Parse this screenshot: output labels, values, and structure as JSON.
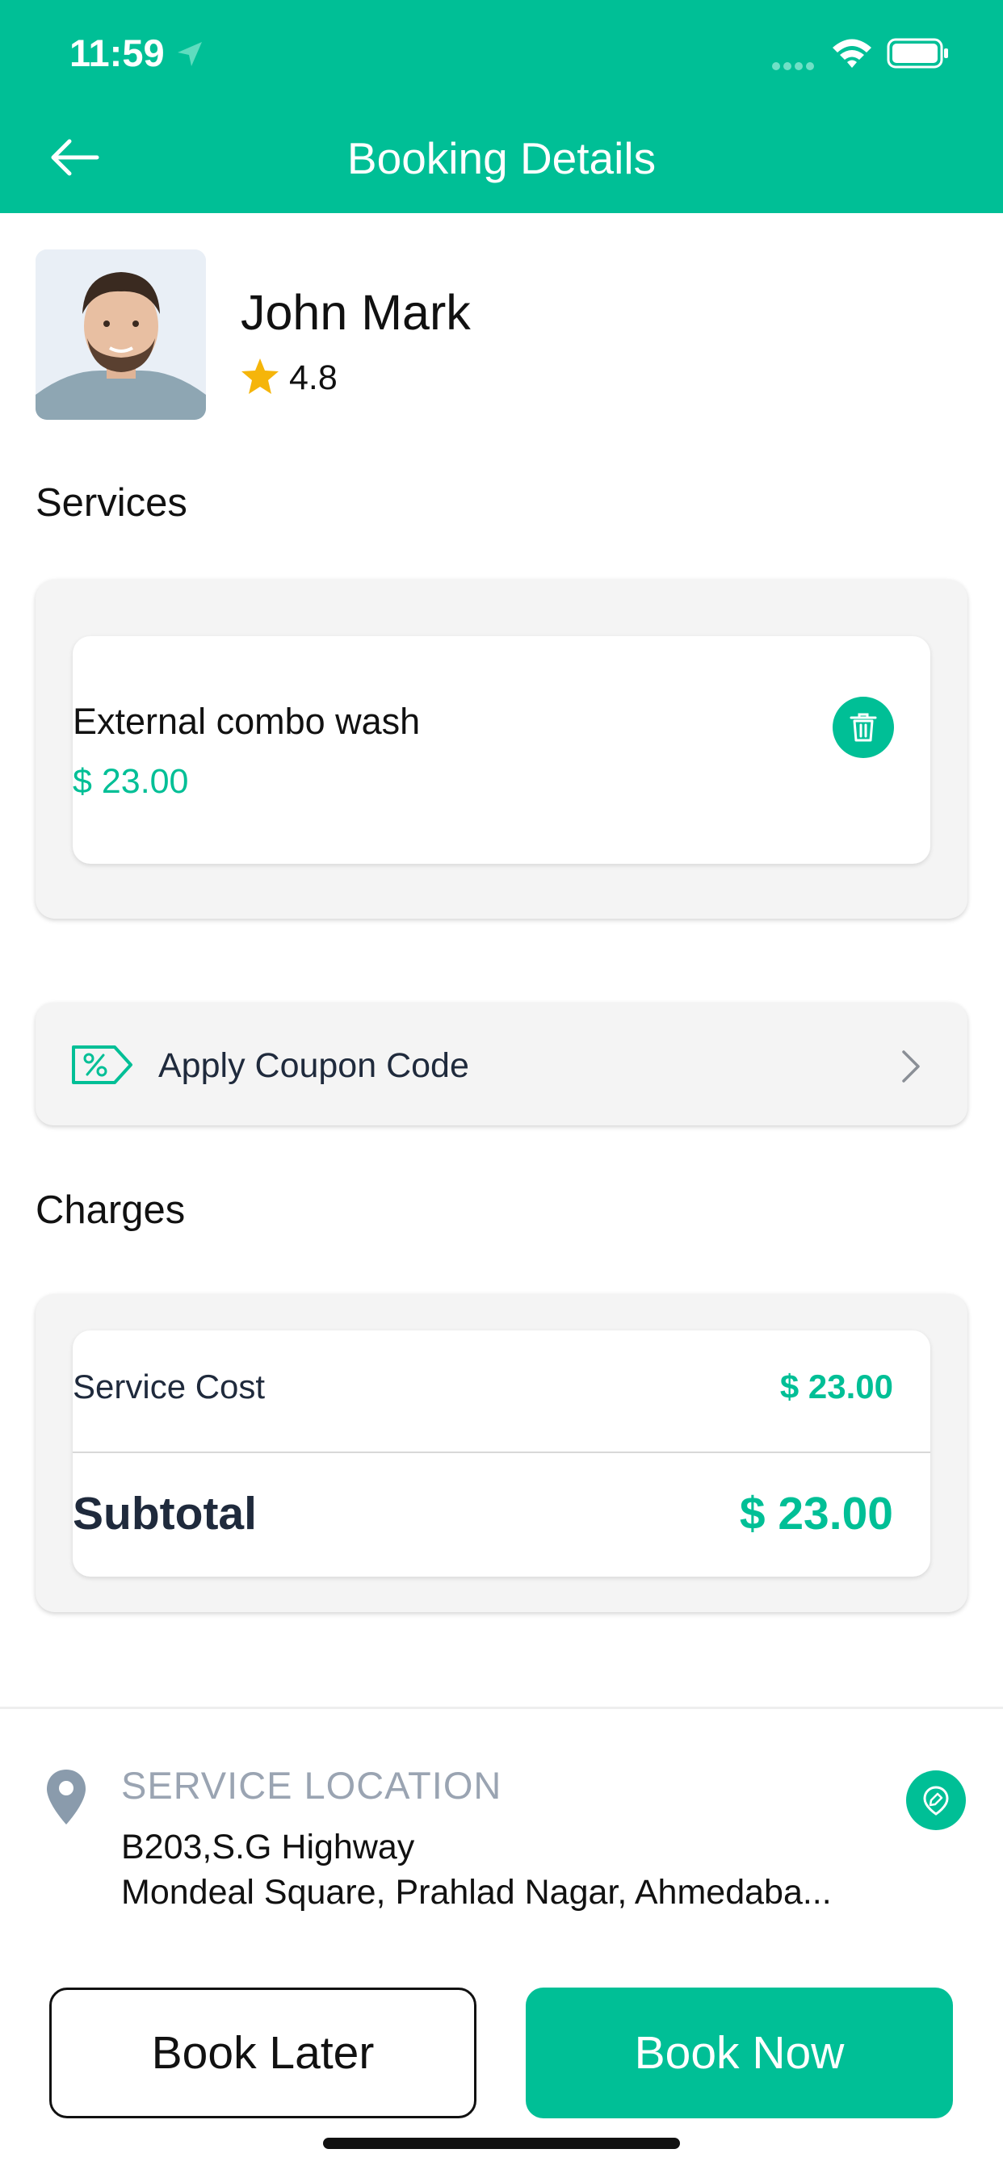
{
  "status_bar": {
    "time": "11:59"
  },
  "header": {
    "title": "Booking Details",
    "back_icon": "arrow-left-icon"
  },
  "provider": {
    "name": "John Mark",
    "rating": "4.8"
  },
  "services": {
    "title": "Services",
    "items": [
      {
        "name": "External combo wash",
        "price": "$ 23.00",
        "action_icon": "trash-icon"
      }
    ]
  },
  "coupon": {
    "label": "Apply Coupon Code",
    "icon": "coupon-tag-icon"
  },
  "charges": {
    "title": "Charges",
    "service_cost_label": "Service Cost",
    "service_cost_value": "$ 23.00",
    "subtotal_label": "Subtotal",
    "subtotal_value": "$ 23.00"
  },
  "location": {
    "title": "SERVICE LOCATION",
    "line1": "B203,S.G Highway",
    "line2": "Mondeal Square, Prahlad Nagar, Ahmedaba..."
  },
  "actions": {
    "book_later": "Book Later",
    "book_now": "Book Now"
  },
  "colors": {
    "accent": "#00BF96",
    "star": "#F5B50A",
    "muted": "#9AA4B2",
    "dark_text": "#1F2A3C"
  }
}
